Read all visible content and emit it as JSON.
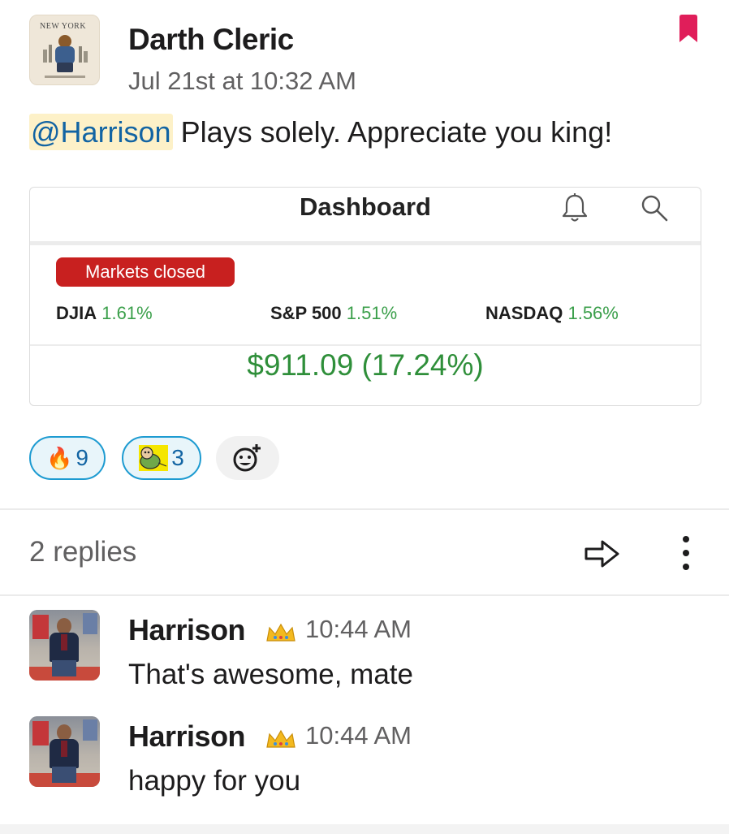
{
  "message": {
    "author": "Darth Cleric",
    "timestamp": "Jul 21st at 10:32 AM",
    "mention": "@Harrison",
    "text": " Plays solely. Appreciate you king!",
    "avatar_text": "NEW YORK"
  },
  "attachment": {
    "title": "Dashboard",
    "status_badge": "Markets closed",
    "indices": [
      {
        "name": "DJIA",
        "change": "1.61%"
      },
      {
        "name": "S&P 500",
        "change": "1.51%"
      },
      {
        "name": "NASDAQ",
        "change": "1.56%"
      }
    ],
    "gain": "$911.09 (17.24%)"
  },
  "reactions": [
    {
      "emoji": "fire",
      "count": "9"
    },
    {
      "emoji": "pepe-baby",
      "count": "3"
    }
  ],
  "thread": {
    "replies_label": "2 replies"
  },
  "replies": [
    {
      "author": "Harrison",
      "badge": "crown",
      "time": "10:44 AM",
      "text": "That's awesome, mate"
    },
    {
      "author": "Harrison",
      "badge": "crown",
      "time": "10:44 AM",
      "text": "happy for you"
    }
  ],
  "colors": {
    "bookmark": "#e01e5a",
    "mention_bg": "#fdf1c8",
    "mention_text": "#1264a3",
    "reaction_border": "#1d9bd1",
    "reaction_bg": "#e8f5fa",
    "badge_red": "#c8201f",
    "gain_green": "#2f8f3a"
  }
}
